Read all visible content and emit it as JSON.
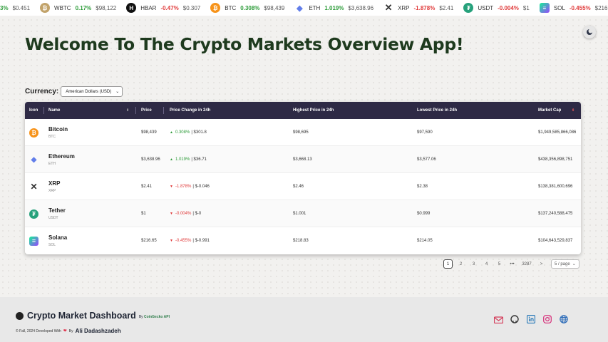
{
  "ticker": [
    {
      "icon": "partial-icon",
      "symbol": "",
      "change": "3%",
      "price": "$0.451",
      "direction": "up",
      "color": "#ffffff"
    },
    {
      "icon": "wbtc-icon",
      "symbol": "WBTC",
      "change": "0.17%",
      "price": "$98,122",
      "direction": "up",
      "color": "#c2a36b"
    },
    {
      "icon": "hbar-icon",
      "symbol": "HBAR",
      "change": "-0.47%",
      "price": "$0.307",
      "direction": "down",
      "color": "#111111"
    },
    {
      "icon": "btc-icon",
      "symbol": "BTC",
      "change": "0.308%",
      "price": "$98,439",
      "direction": "up",
      "color": "#f7931a"
    },
    {
      "icon": "eth-icon",
      "symbol": "ETH",
      "change": "1.019%",
      "price": "$3,638.96",
      "direction": "up",
      "color": "#627eea"
    },
    {
      "icon": "xrp-icon",
      "symbol": "XRP",
      "change": "-1.878%",
      "price": "$2.41",
      "direction": "down",
      "color": "#333333"
    },
    {
      "icon": "usdt-icon",
      "symbol": "USDT",
      "change": "-0.004%",
      "price": "$1",
      "direction": "down",
      "color": "#26a17b"
    },
    {
      "icon": "sol-icon",
      "symbol": "SOL",
      "change": "-0.455%",
      "price": "$216",
      "direction": "down",
      "color": "#9945ff"
    }
  ],
  "page_title": "Welcome To The Crypto Markets Overview App!",
  "currency": {
    "label": "Currency:",
    "selected": "American Dollars (USD)"
  },
  "table": {
    "headers": {
      "icon": "Icon",
      "name": "Name",
      "price": "Price",
      "change": "Price Change in 24h",
      "high": "Highest Price in 24h",
      "low": "Lowest Price in 24h",
      "cap": "Market Cap"
    },
    "rows": [
      {
        "icon": "btc-icon",
        "color": "#f7931a",
        "name": "Bitcoin",
        "symbol": "BTC",
        "price": "$98,439",
        "change_pct": "0.308%",
        "change_abs": "| $301.8",
        "direction": "up",
        "high": "$98,695",
        "low": "$97,590",
        "cap": "$1,949,585,866,086"
      },
      {
        "icon": "eth-icon",
        "color": "#627eea",
        "name": "Ethereum",
        "symbol": "ETH",
        "price": "$3,638.96",
        "change_pct": "1.019%",
        "change_abs": "| $36.71",
        "direction": "up",
        "high": "$3,668.13",
        "low": "$3,577.06",
        "cap": "$438,356,898,751"
      },
      {
        "icon": "xrp-icon",
        "color": "#333333",
        "name": "XRP",
        "symbol": "XRP",
        "price": "$2.41",
        "change_pct": "-1.878%",
        "change_abs": "| $-0.046",
        "direction": "down",
        "high": "$2.46",
        "low": "$2.38",
        "cap": "$138,381,600,696"
      },
      {
        "icon": "usdt-icon",
        "color": "#26a17b",
        "name": "Tether",
        "symbol": "USDT",
        "price": "$1",
        "change_pct": "-0.004%",
        "change_abs": "| $-0",
        "direction": "down",
        "high": "$1.001",
        "low": "$0.999",
        "cap": "$137,240,588,475"
      },
      {
        "icon": "sol-icon",
        "color": "#9945ff",
        "name": "Solana",
        "symbol": "SOL",
        "price": "$216.65",
        "change_pct": "-0.455%",
        "change_abs": "| $-0.991",
        "direction": "down",
        "high": "$218.83",
        "low": "$214.05",
        "cap": "$104,643,529,837"
      }
    ]
  },
  "pagination": {
    "pages": [
      "1",
      "2",
      "3",
      "4",
      "5"
    ],
    "ellipsis": "•••",
    "last": "3287",
    "next": ">",
    "page_size": "5 / page",
    "current": "1"
  },
  "footer": {
    "brand": "Crypto Market Dashboard",
    "by_prefix": "By ",
    "by_source": "CoinGecko API",
    "copyright": "© Fall, 2024 Developed With",
    "by": "By",
    "author": "Ali Dadashzadeh",
    "socials": [
      "email-icon",
      "github-icon",
      "linkedin-icon",
      "instagram-icon",
      "globe-icon"
    ]
  },
  "colors": {
    "header_bg": "#2e2a45",
    "title": "#1e3a1e",
    "up": "#2e9c3a",
    "down": "#e03a3a"
  }
}
